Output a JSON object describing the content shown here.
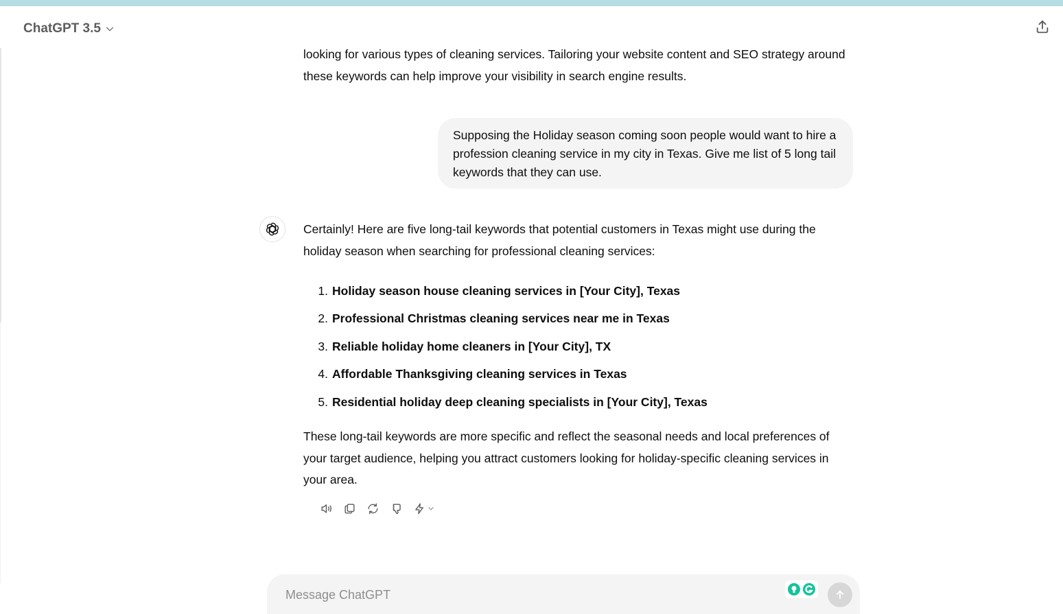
{
  "header": {
    "model_label": "ChatGPT 3.5"
  },
  "conversation": {
    "previous_assistant_tail": "looking for various types of cleaning services. Tailoring your website content and SEO strategy around these keywords can help improve your visibility in search engine results.",
    "user_message": "Supposing the Holiday season coming soon people would want to hire a profession cleaning service in my city in Texas. Give me list of 5 long tail keywords that they can use.",
    "assistant_intro": "Certainly! Here are five long-tail keywords that potential customers in Texas might use during the holiday season when searching for professional cleaning services:",
    "keywords": [
      {
        "num": "1.",
        "text": "Holiday season house cleaning services in [Your City], Texas"
      },
      {
        "num": "2.",
        "text": "Professional Christmas cleaning services near me in Texas"
      },
      {
        "num": "3.",
        "text": "Reliable holiday home cleaners in [Your City], TX"
      },
      {
        "num": "4.",
        "text": "Affordable Thanksgiving cleaning services in Texas"
      },
      {
        "num": "5.",
        "text": "Residential holiday deep cleaning specialists in [Your City], Texas"
      }
    ],
    "assistant_outro": "These long-tail keywords are more specific and reflect the seasonal needs and local preferences of your target audience, helping you attract customers looking for holiday-specific cleaning services in your area."
  },
  "message_actions": [
    "read-aloud-icon",
    "copy-icon",
    "regenerate-icon",
    "thumbs-down-icon",
    "lightning-icon",
    "chevron-down-icon"
  ],
  "composer": {
    "placeholder": "Message ChatGPT"
  },
  "colors": {
    "top_strip": "#b5dde3",
    "bubble_bg": "#f4f4f4",
    "send_button_disabled": "#d7d7d7",
    "grammarly_green": "#15c39a"
  }
}
